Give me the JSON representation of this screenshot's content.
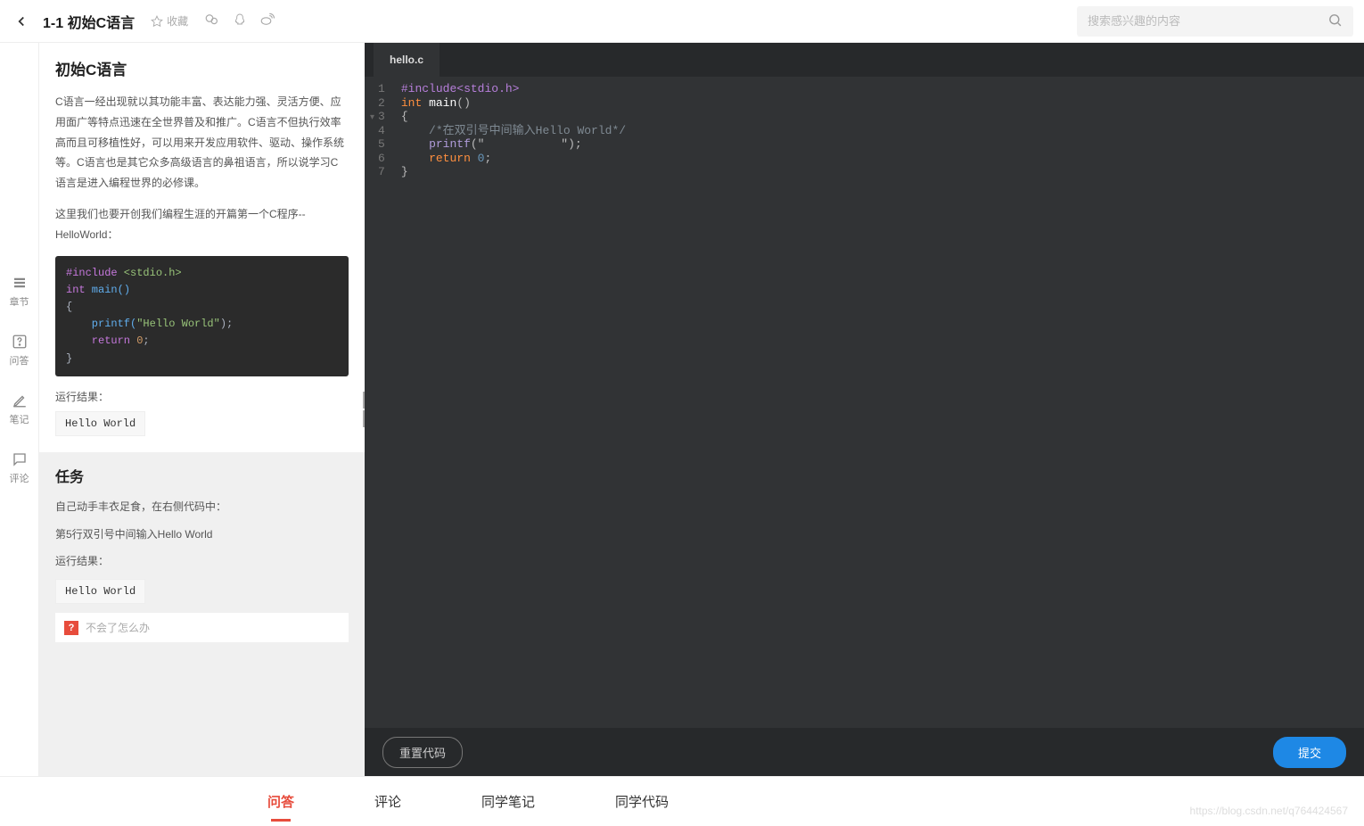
{
  "header": {
    "title": "1-1 初始C语言",
    "favorite": "收藏",
    "search_placeholder": "搜索感兴趣的内容"
  },
  "leftnav": {
    "chapters": "章节",
    "qa": "问答",
    "notes": "笔记",
    "comments": "评论"
  },
  "article": {
    "heading": "初始C语言",
    "p1": "C语言一经出现就以其功能丰富、表达能力强、灵活方便、应用面广等特点迅速在全世界普及和推广。C语言不但执行效率高而且可移植性好，可以用来开发应用软件、驱动、操作系统等。C语言也是其它众多高级语言的鼻祖语言，所以说学习C语言是进入编程世界的必修课。",
    "p2": "这里我们也要开创我们编程生涯的开篇第一个C程序--HelloWorld：",
    "run_label": "运行结果：",
    "run_result": "Hello World"
  },
  "example_code": {
    "l1a": "#include",
    "l1b": " <stdio.h>",
    "l2a": "int",
    "l2b": " main()",
    "l3": "{",
    "l4a": "    printf(",
    "l4b": "\"Hello World\"",
    "l4c": ");",
    "l5a": "    return ",
    "l5b": "0",
    "l5c": ";",
    "l6": "}"
  },
  "task": {
    "heading": "任务",
    "p1": "自己动手丰衣足食，在右侧代码中：",
    "p2": "第5行双引号中间输入Hello World",
    "run_label": "运行结果：",
    "run_result": "Hello World",
    "help": "不会了怎么办",
    "help_icon": "?"
  },
  "editor": {
    "filename": "hello.c",
    "gutter": [
      "1",
      "2",
      "3",
      "4",
      "5",
      "6",
      "7"
    ],
    "code": {
      "l1a": "#include",
      "l1b": "<stdio.h>",
      "l2a": "int ",
      "l2b": "main",
      "l2c": "()",
      "l3": "{",
      "l4": "    /*在双引号中间输入Hello World*/",
      "l5a": "    ",
      "l5b": "printf",
      "l5c": "(\"           \");",
      "l6a": "    ",
      "l6b": "return ",
      "l6c": "0",
      "l6d": ";",
      "l7": "}"
    },
    "reset": "重置代码",
    "submit": "提交"
  },
  "bottom_tabs": {
    "qa": "问答",
    "comments": "评论",
    "classmate_notes": "同学笔记",
    "classmate_code": "同学代码"
  },
  "watermark": "https://blog.csdn.net/q764424567"
}
